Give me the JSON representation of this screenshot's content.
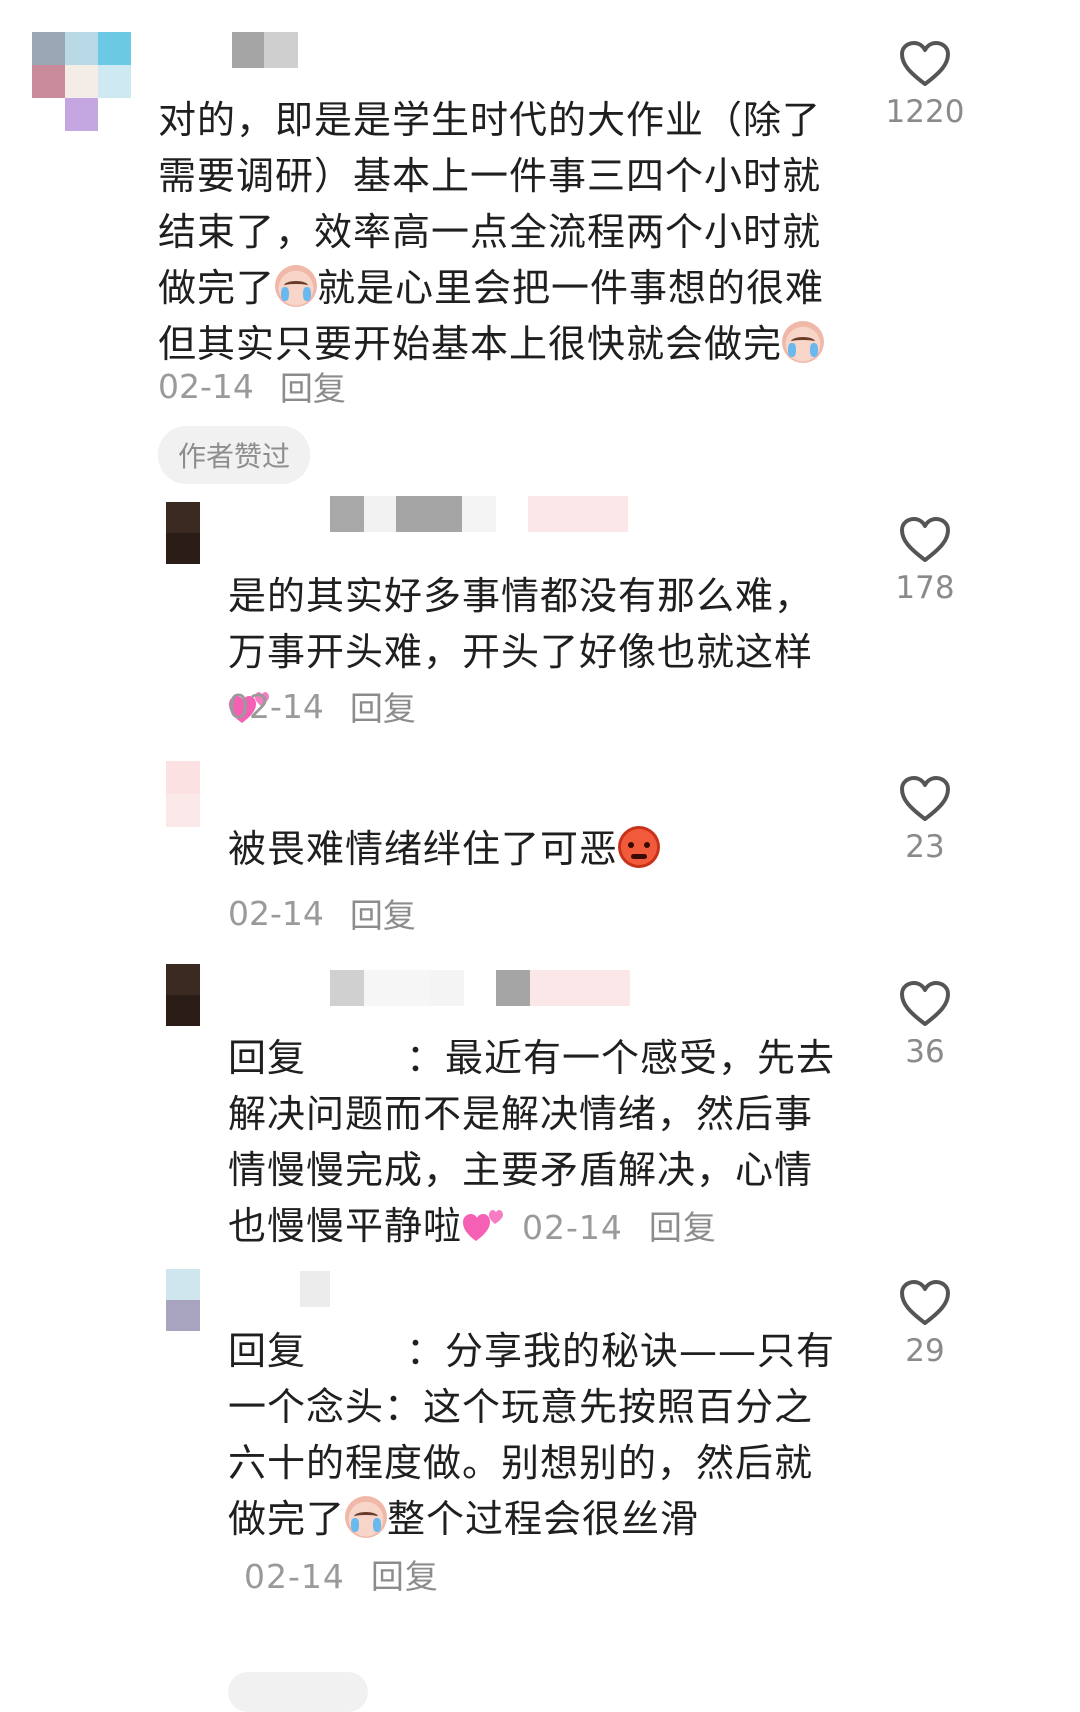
{
  "comments": [
    {
      "text_before": "对的，即是是学生时代的大作业（除了需要调研）基本上一件事三四个小时就结束了，效率高一点全流程两个小时就做完了",
      "emoji1": "loudly-crying-face",
      "text_mid": "就是心里会把一件事想的很难但其实只要开始基本上很快就会做完",
      "emoji2": "loudly-crying-face",
      "date": "02-14",
      "reply": "回复",
      "badge": "作者赞过",
      "likes": "1220"
    },
    {
      "text_before": "是的其实好多事情都没有那么难，万事开头难，开头了好像也就这样",
      "emoji1": "two-hearts",
      "date": "02-14",
      "reply": "回复",
      "likes": "178"
    },
    {
      "text_before": "被畏难情绪绊住了可恶",
      "emoji1": "angry-face",
      "date": "02-14",
      "reply": "回复",
      "likes": "23"
    },
    {
      "prefix": "回复",
      "colon": "：",
      "text_before": "最近有一个感受，先去解决问题而不是解决情绪，然后事情慢慢完成，主要矛盾解决，心情也慢慢平静啦",
      "emoji1": "two-hearts",
      "date": "02-14",
      "reply": "回复",
      "likes": "36"
    },
    {
      "prefix": "回复",
      "colon": "：",
      "text_before": "分享我的秘诀——只有一个念头：这个玩意先按照百分之六十的程度做。别想别的，然后就做完了",
      "emoji1": "loudly-crying-face",
      "text_mid": "整个过程会很丝滑",
      "date": "02-14",
      "reply": "回复",
      "likes": "29"
    }
  ],
  "icons": {
    "like": "heart-outline-icon"
  },
  "colors": {
    "text": "#1f1f1f",
    "meta": "#9a9a9a",
    "badge_bg": "#f1f1f1"
  }
}
